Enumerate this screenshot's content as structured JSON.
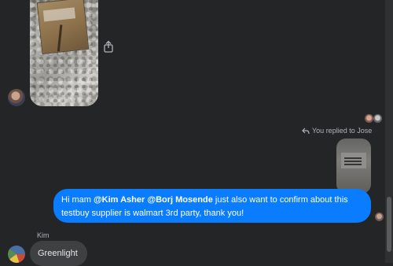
{
  "conversation": {
    "replied_label": "You replied to Jose",
    "sent_message": {
      "line1_prefix": "Hi mam ",
      "mention1": "@Kim Asher",
      "mention2": "@Borj Mosende",
      "line1_suffix": " just also want to confirm about this",
      "line2": "testbuy supplier is walmart 3rd party, thank you!"
    },
    "received_message": {
      "sender": "Kim",
      "text": "Greenlight"
    }
  },
  "icons": {
    "share": "share-icon",
    "reply": "reply-arrow-icon"
  },
  "colors": {
    "background": "#242526",
    "sent_bubble": "#0a7cff",
    "received_bubble": "#3e4042"
  }
}
